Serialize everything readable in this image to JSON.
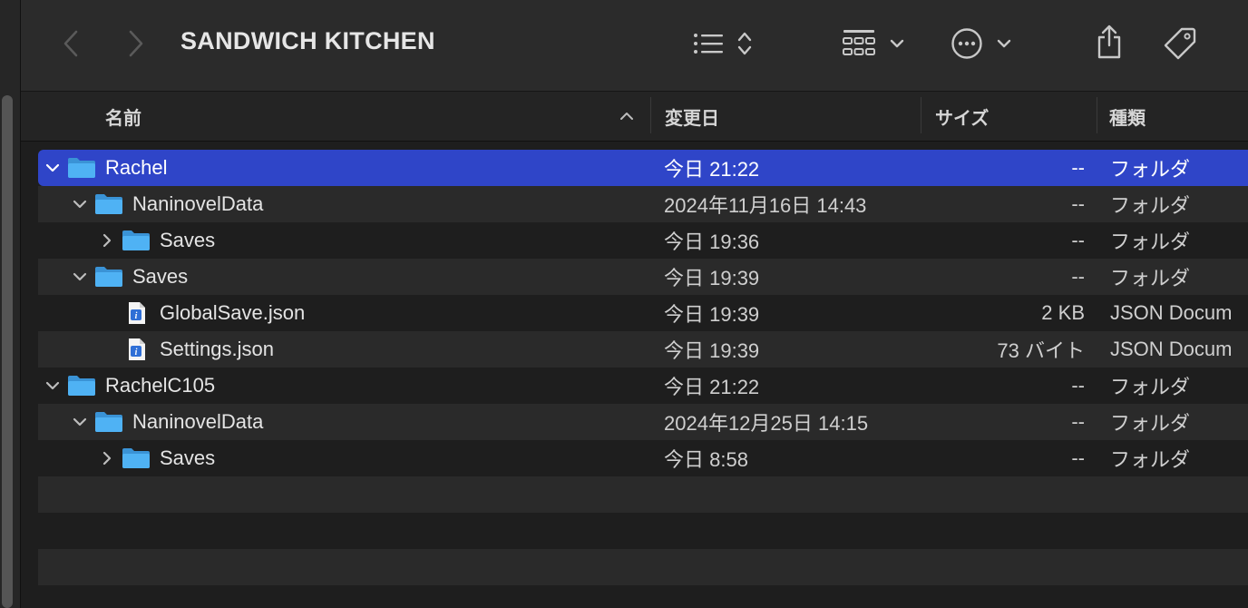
{
  "toolbar": {
    "title": "SANDWICH KITCHEN",
    "icons": [
      "back-icon",
      "forward-icon",
      "list-view-icon",
      "sort-updown-icon",
      "group-grid-icon",
      "chevron-down-icon",
      "more-icon",
      "share-icon",
      "tag-icon"
    ]
  },
  "columns": {
    "name": "名前",
    "date": "変更日",
    "size": "サイズ",
    "kind": "種類"
  },
  "colors": {
    "selection": "#2f45c8",
    "folder": "#4fb2f4",
    "background": "#1e1e1e"
  },
  "rows": [
    {
      "name": "Rachel",
      "date": "今日 21:22",
      "size": "--",
      "kind": "フォルダ",
      "type": "folder",
      "depth": 0,
      "expanded": true,
      "selected": true
    },
    {
      "name": "NaninovelData",
      "date": "2024年11月16日 14:43",
      "size": "--",
      "kind": "フォルダ",
      "type": "folder",
      "depth": 1,
      "expanded": true
    },
    {
      "name": "Saves",
      "date": "今日 19:36",
      "size": "--",
      "kind": "フォルダ",
      "type": "folder",
      "depth": 2,
      "expanded": false
    },
    {
      "name": "Saves",
      "date": "今日 19:39",
      "size": "--",
      "kind": "フォルダ",
      "type": "folder",
      "depth": 1,
      "expanded": true
    },
    {
      "name": "GlobalSave.json",
      "date": "今日 19:39",
      "size": "2 KB",
      "kind": "JSON Docum",
      "type": "file",
      "depth": 2
    },
    {
      "name": "Settings.json",
      "date": "今日 19:39",
      "size": "73 バイト",
      "kind": "JSON Docum",
      "type": "file",
      "depth": 2
    },
    {
      "name": "RachelC105",
      "date": "今日 21:22",
      "size": "--",
      "kind": "フォルダ",
      "type": "folder",
      "depth": 0,
      "expanded": true
    },
    {
      "name": "NaninovelData",
      "date": "2024年12月25日 14:15",
      "size": "--",
      "kind": "フォルダ",
      "type": "folder",
      "depth": 1,
      "expanded": true
    },
    {
      "name": "Saves",
      "date": "今日 8:58",
      "size": "--",
      "kind": "フォルダ",
      "type": "folder",
      "depth": 2,
      "expanded": false
    }
  ]
}
